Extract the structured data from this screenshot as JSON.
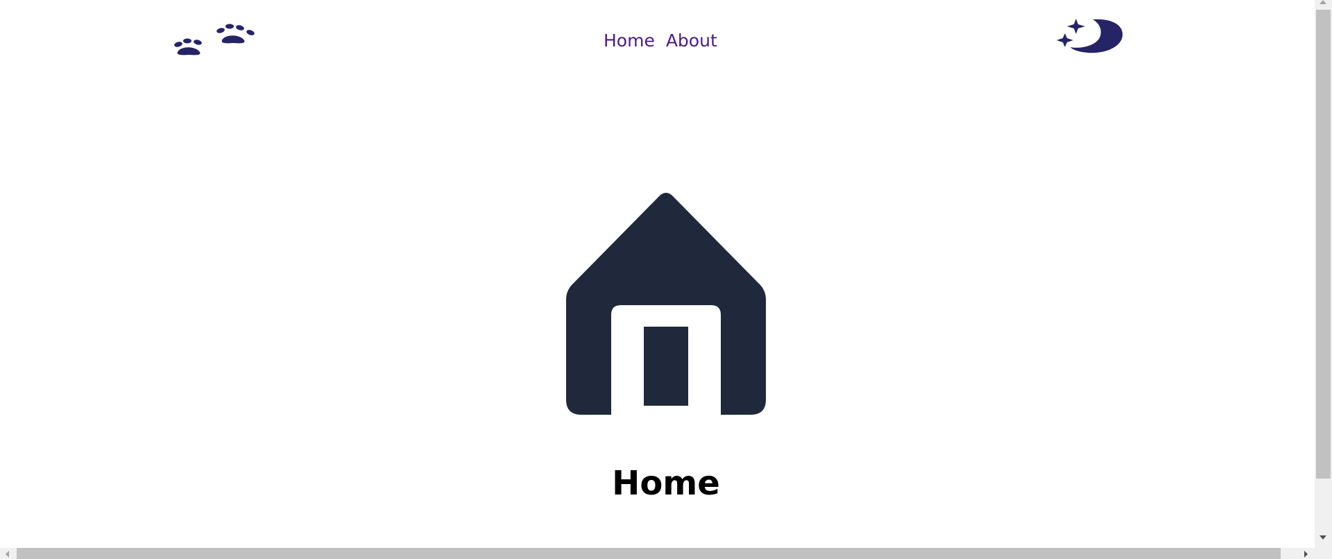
{
  "header": {
    "logo_icon": "paw-prints-icon",
    "nav": [
      {
        "label": "Home"
      },
      {
        "label": "About"
      }
    ],
    "theme_toggle_icon": "moon-stars-icon"
  },
  "main": {
    "hero_icon": "house-icon",
    "title": "Home"
  },
  "colors": {
    "accent": "#252466",
    "nav_text": "#4a1a8c",
    "icon_dark": "#1f293b",
    "background": "#ffffff"
  }
}
